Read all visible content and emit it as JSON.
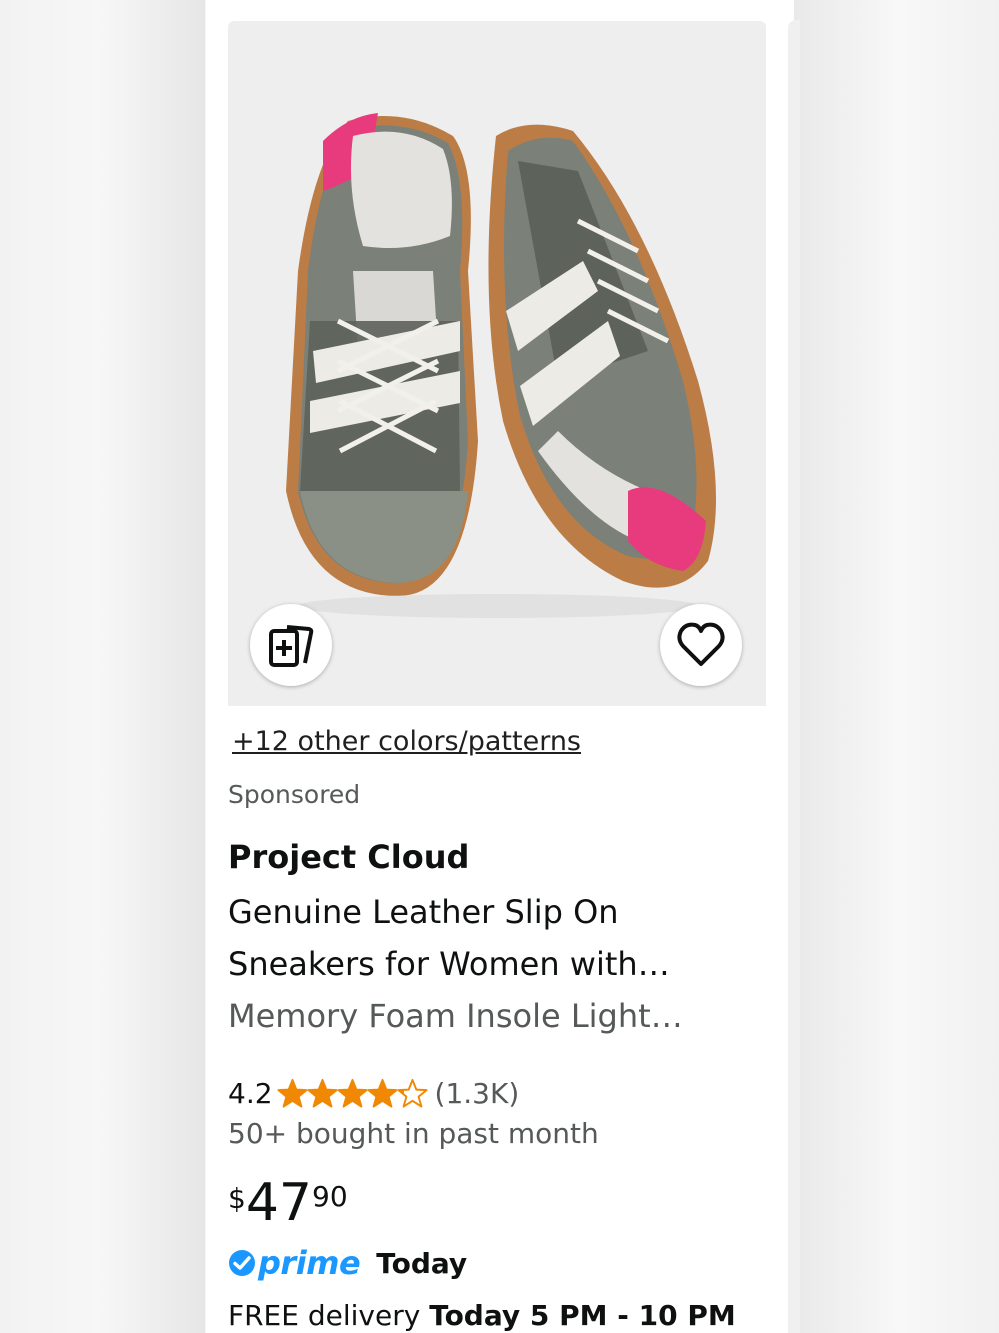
{
  "product": {
    "colors_link": "+12 other colors/patterns",
    "sponsored": "Sponsored",
    "brand": "Project Cloud",
    "title_lines": [
      "Genuine Leather Slip On",
      "Sneakers for Women with…",
      "Memory Foam Insole Light…"
    ],
    "rating": "4.2",
    "rating_stars": 4.2,
    "review_count": "(1.3K)",
    "bought": "50+ bought in past month",
    "price": {
      "symbol": "$",
      "whole": "47",
      "fraction": "90"
    },
    "prime": {
      "label": "prime",
      "today": "Today"
    },
    "delivery": {
      "prefix": "FREE delivery",
      "window": "Today 5 PM - 10 PM"
    }
  },
  "icons": {
    "compare": "compare-cards-icon",
    "favorite": "heart-icon",
    "star": "star-icon",
    "prime_check": "prime-check-icon"
  },
  "colors": {
    "star": "#f08804",
    "prime": "#1a98ff",
    "text": "#0f1111",
    "muted": "#565959",
    "image_bg": "#eeeeee"
  }
}
